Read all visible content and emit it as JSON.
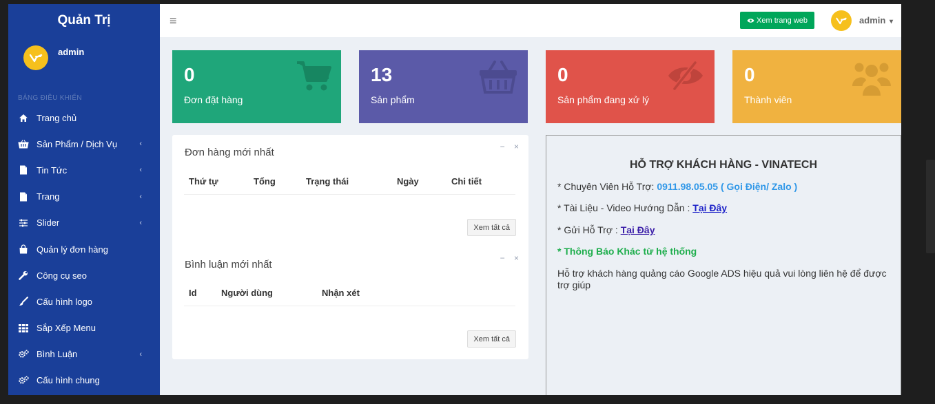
{
  "sidebar": {
    "brand": "Quản Trị",
    "user_name": "admin",
    "menu_header": "BẢNG ĐIỀU KHIỂN",
    "items": [
      {
        "label": "Trang chủ",
        "icon": "home-icon",
        "arrow": ""
      },
      {
        "label": "Sản Phẩm / Dịch Vụ",
        "icon": "basket-icon",
        "arrow": "‹"
      },
      {
        "label": "Tin Tức",
        "icon": "file-icon",
        "arrow": "‹"
      },
      {
        "label": "Trang",
        "icon": "file-icon",
        "arrow": "‹"
      },
      {
        "label": "Slider",
        "icon": "sliders-icon",
        "arrow": "‹"
      },
      {
        "label": "Quản lý đơn hàng",
        "icon": "shopping-bag-icon",
        "arrow": ""
      },
      {
        "label": "Công cụ seo",
        "icon": "wrench-icon",
        "arrow": ""
      },
      {
        "label": "Cấu hình logo",
        "icon": "paintbrush-icon",
        "arrow": ""
      },
      {
        "label": "Sắp Xếp Menu",
        "icon": "grid-icon",
        "arrow": ""
      },
      {
        "label": "Bình Luận",
        "icon": "cogs-icon",
        "arrow": "‹"
      },
      {
        "label": "Cấu hình chung",
        "icon": "cogs-icon",
        "arrow": ""
      }
    ]
  },
  "topbar": {
    "menu_toggle": "≡",
    "visit_site_label": "Xem trang web",
    "user_name": "admin",
    "caret": "▾"
  },
  "stats": [
    {
      "value": "0",
      "label": "Đơn đặt hàng",
      "color": "#1fa67a",
      "icon": "shopping-cart-icon"
    },
    {
      "value": "13",
      "label": "Sản phẩm",
      "color": "#5b5aa8",
      "icon": "basket-icon"
    },
    {
      "value": "0",
      "label": "Sản phẩm đang xử lý",
      "color": "#e0534a",
      "icon": "eye-slash-icon"
    },
    {
      "value": "0",
      "label": "Thành viên",
      "color": "#f0b240",
      "icon": "users-icon"
    }
  ],
  "orders_panel": {
    "title": "Đơn hàng mới nhất",
    "columns": [
      "Thứ tự",
      "Tổng",
      "Trạng thái",
      "Ngày",
      "Chi tiết"
    ],
    "view_all": "Xem tất cả"
  },
  "comments_panel": {
    "title": "Bình luận mới nhất",
    "columns": [
      "Id",
      "Người dùng",
      "Nhận xét"
    ],
    "view_all": "Xem tất cả"
  },
  "panel_tools": {
    "minimize": "−",
    "close": "×"
  },
  "support": {
    "title": "HỖ TRỢ KHÁCH HÀNG - VINATECH",
    "phone_prefix": "* Chuyên Viên Hỗ Trợ: ",
    "phone": "0911.98.05.05 ( Gọi Điện/ Zalo )",
    "docs_prefix": "* Tài Liệu - Video Hướng Dẫn : ",
    "docs_link": "Tại Đây",
    "send_prefix": "* Gửi Hỗ Trợ : ",
    "send_link": "Tại Đây",
    "notice": "* Thông Báo Khác từ hệ thống",
    "note": "Hỗ trợ khách hàng quảng cáo Google ADS hiệu quả vui lòng liên hệ để được trợ giúp"
  },
  "colors": {
    "sidebar_bg": "#1a3f99",
    "visit_button": "#00a65a",
    "avatar": "#f6c01c"
  }
}
